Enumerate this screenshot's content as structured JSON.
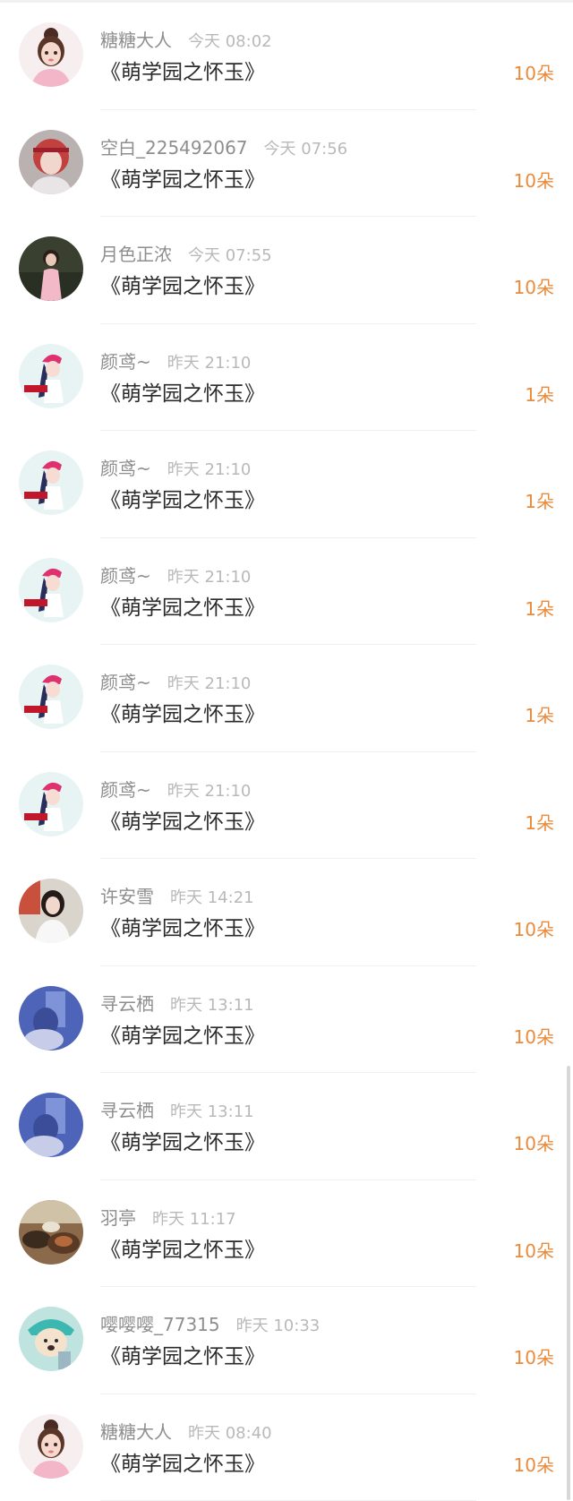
{
  "items": [
    {
      "name": "糖糖大人",
      "time": "今天 08:02",
      "title": "《萌学园之怀玉》",
      "amount": "10朵",
      "avatar": "cartoon-girl-avatar"
    },
    {
      "name": "空白_225492067",
      "time": "今天 07:56",
      "title": "《萌学园之怀玉》",
      "amount": "10朵",
      "avatar": "red-hair-girl-avatar"
    },
    {
      "name": "月色正浓",
      "time": "今天 07:55",
      "title": "《萌学园之怀玉》",
      "amount": "10朵",
      "avatar": "dark-photo-avatar"
    },
    {
      "name": "颜鸢~",
      "time": "昨天 21:10",
      "title": "《萌学园之怀玉》",
      "amount": "1朵",
      "avatar": "anime-girl-pink-hat-avatar"
    },
    {
      "name": "颜鸢~",
      "time": "昨天 21:10",
      "title": "《萌学园之怀玉》",
      "amount": "1朵",
      "avatar": "anime-girl-pink-hat-avatar"
    },
    {
      "name": "颜鸢~",
      "time": "昨天 21:10",
      "title": "《萌学园之怀玉》",
      "amount": "1朵",
      "avatar": "anime-girl-pink-hat-avatar"
    },
    {
      "name": "颜鸢~",
      "time": "昨天 21:10",
      "title": "《萌学园之怀玉》",
      "amount": "1朵",
      "avatar": "anime-girl-pink-hat-avatar"
    },
    {
      "name": "颜鸢~",
      "time": "昨天 21:10",
      "title": "《萌学园之怀玉》",
      "amount": "1朵",
      "avatar": "anime-girl-pink-hat-avatar"
    },
    {
      "name": "许安雪",
      "time": "昨天 14:21",
      "title": "《萌学园之怀玉》",
      "amount": "10朵",
      "avatar": "girl-photo-avatar"
    },
    {
      "name": "寻云栖",
      "time": "昨天 13:11",
      "title": "《萌学园之怀玉》",
      "amount": "10朵",
      "avatar": "blue-blur-avatar"
    },
    {
      "name": "寻云栖",
      "time": "昨天 13:11",
      "title": "《萌学园之怀玉》",
      "amount": "10朵",
      "avatar": "blue-blur-avatar"
    },
    {
      "name": "羽亭",
      "time": "昨天 11:17",
      "title": "《萌学园之怀玉》",
      "amount": "10朵",
      "avatar": "food-photo-avatar"
    },
    {
      "name": "嘤嘤嘤_77315",
      "time": "昨天 10:33",
      "title": "《萌学园之怀玉》",
      "amount": "10朵",
      "avatar": "dog-photo-avatar"
    },
    {
      "name": "糖糖大人",
      "time": "昨天 08:40",
      "title": "《萌学园之怀玉》",
      "amount": "10朵",
      "avatar": "cartoon-girl-avatar"
    }
  ],
  "colors": {
    "amount": "#ea8a3a",
    "name": "#8e8e8e",
    "time": "#b9b9b9",
    "title": "#2b2b2b",
    "divider": "#f0f0f0"
  }
}
